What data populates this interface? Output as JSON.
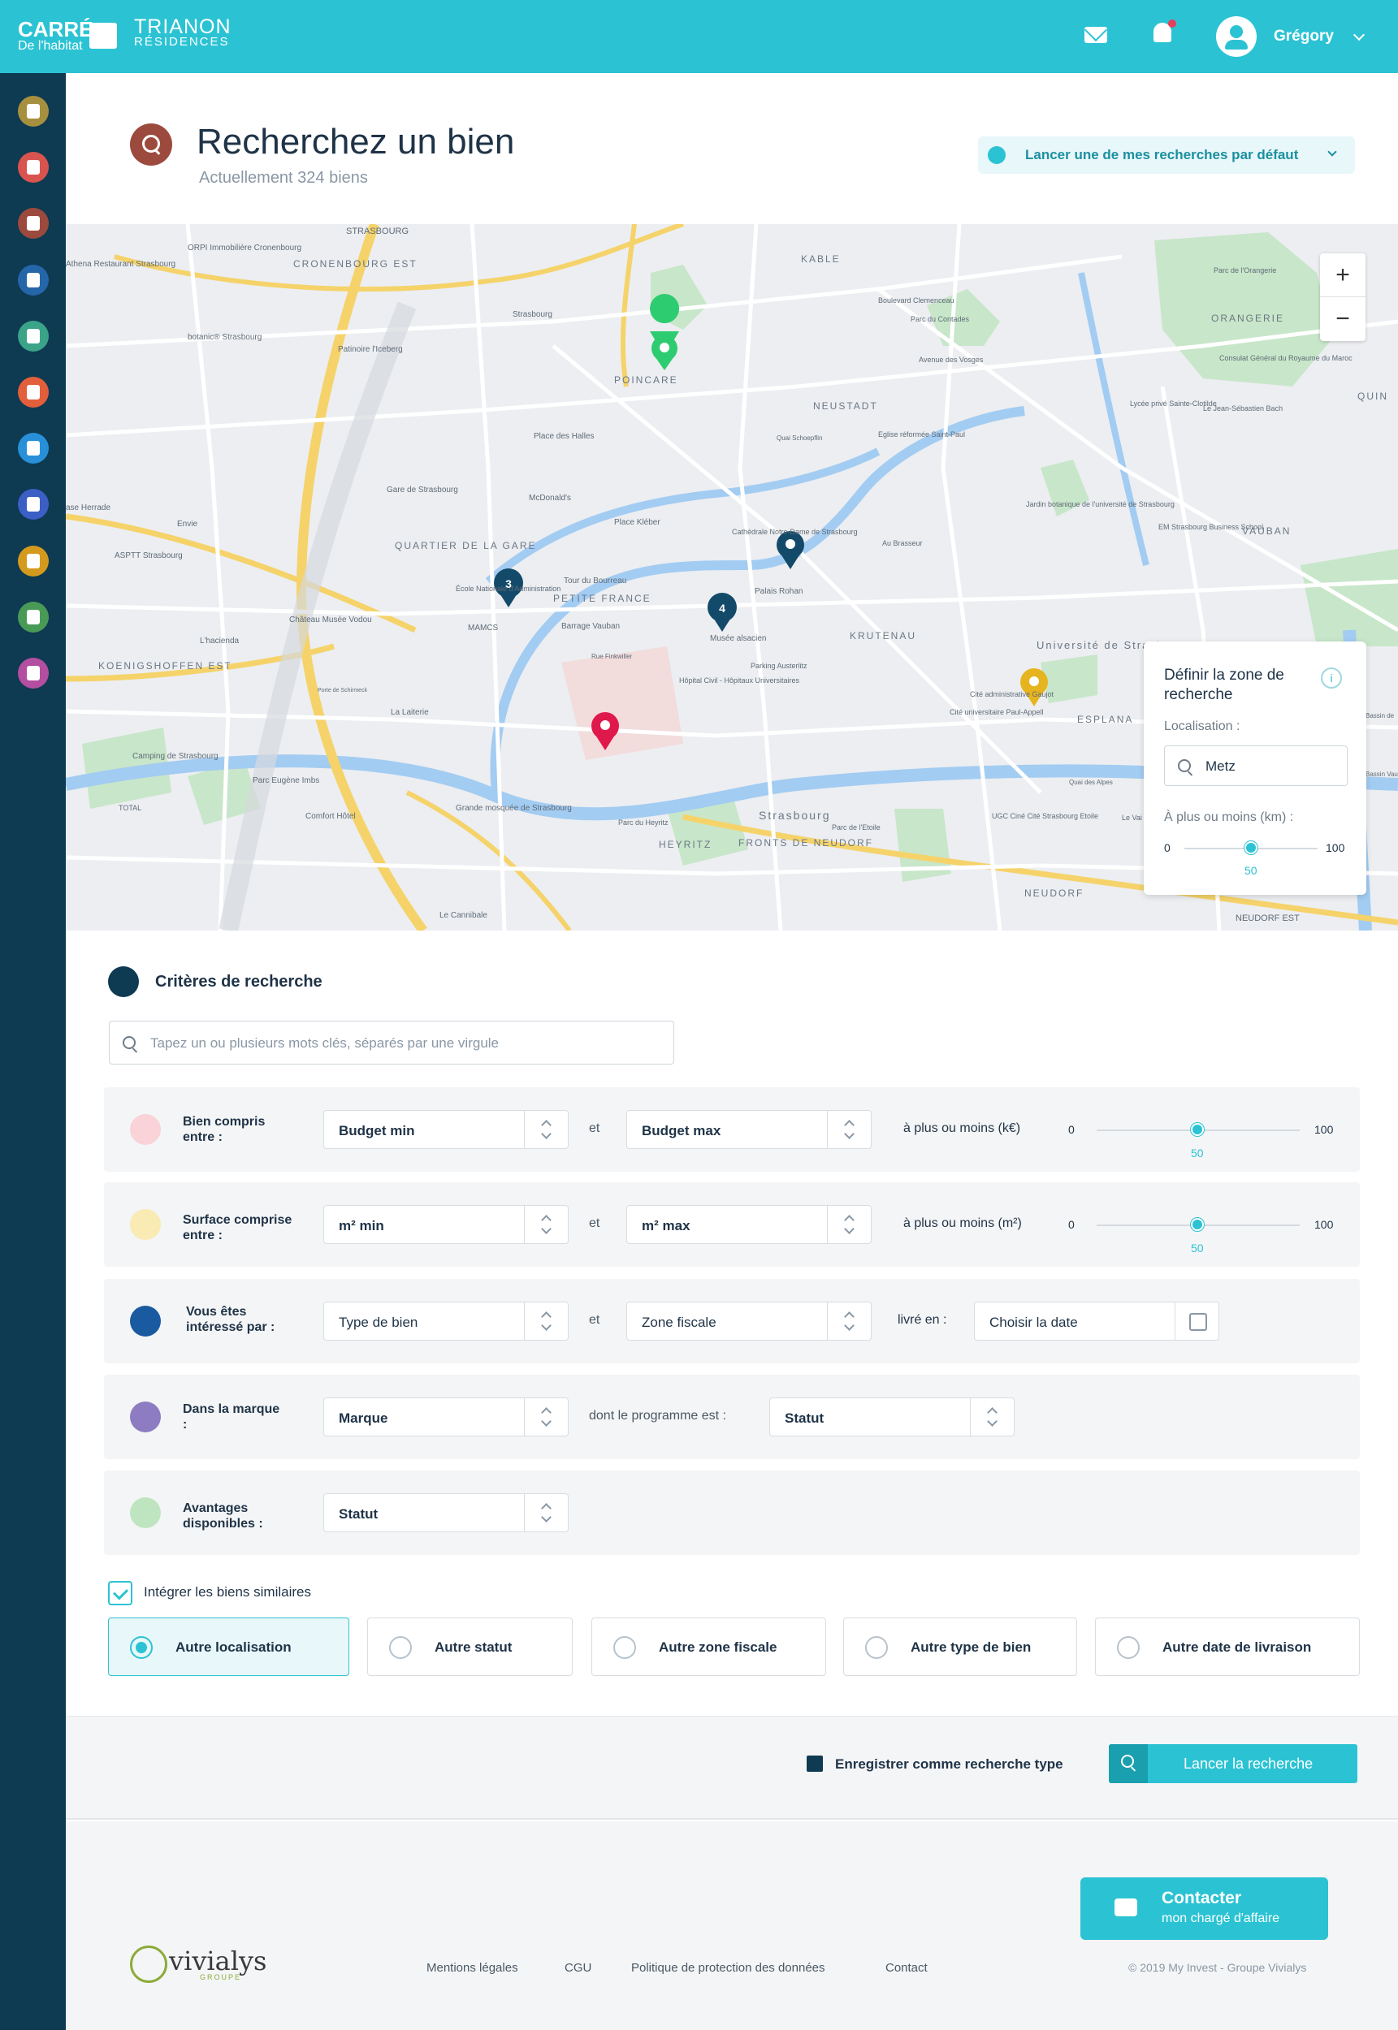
{
  "header": {
    "brand_main": "CARRÉ",
    "brand_sub": "De l'habitat",
    "brand2_main": "TRIANON",
    "brand2_sub": "RÉSIDENCES",
    "user_name": "Grégory",
    "accent_color": "#2bc3d3",
    "notification_dot_color": "#e83e5a"
  },
  "sidebar": {
    "background": "#0e3a52",
    "items": [
      {
        "icon": "clipboard-icon",
        "color": "#a6903f"
      },
      {
        "icon": "users-icon",
        "color": "#d9534f"
      },
      {
        "icon": "search-icon",
        "color": "#9c4a3d"
      },
      {
        "icon": "home-icon",
        "color": "#2466a8"
      },
      {
        "icon": "star-icon",
        "color": "#3aa388"
      },
      {
        "icon": "bell-icon",
        "color": "#e35f3b"
      },
      {
        "icon": "book-icon",
        "color": "#2790d8"
      },
      {
        "icon": "calendar-icon",
        "color": "#3b5fc4"
      },
      {
        "icon": "document-icon",
        "color": "#d49a1d"
      },
      {
        "icon": "stack-icon",
        "color": "#4a9a57"
      },
      {
        "icon": "profile-icon",
        "color": "#b34ea1"
      }
    ]
  },
  "page": {
    "title": "Recherchez un bien",
    "subtitle": "Actuellement 324 biens",
    "default_search_label": "Lancer une de mes recherches par défaut"
  },
  "map": {
    "labels": [
      "STRASBOURG",
      "Athena Restaurant Strasbourg",
      "ORPI Immobilière Cronenbourg",
      "CRONENBOURG EST",
      "KABLE",
      "botanic® Strasbourg",
      "Patinoire l'Iceberg",
      "Strasbourg",
      "Boulevard Clemenceau",
      "Parc du Contades",
      "Parc de l'Orangerie",
      "ORANGERIE",
      "Consulat Général du Royaume du Maroc",
      "QUIN",
      "POINCARE",
      "Avenue des Vosges",
      "NEUSTADT",
      "Lycée privé Sainte-Clotilde",
      "Le Jean-Sébastien Bach",
      "Place des Halles",
      "Quai Schoepflin",
      "Eglise réformée Saint-Paul",
      "Gare de Strasbourg",
      "McDonald's",
      "Place Kléber",
      "Jardin botanique de l'université de Strasbourg",
      "EM Strasbourg Business School",
      "VAUBAN",
      "ase Herrade",
      "Envie",
      "ASPTT Strasbourg",
      "QUARTIER DE LA GARE",
      "Cathédrale Notre-Dame de Strasbourg",
      "Au Brasseur",
      "École Nationale d'Administration",
      "Tour du Bourreau",
      "PETITE FRANCE",
      "Palais Rohan",
      "Château Musée Vodou",
      "MAMCS",
      "Barrage Vauban",
      "Musée alsacien",
      "KRUTENAU",
      "Université de Strasbourg",
      "L'hacienda",
      "KOENIGSHOFFEN EST",
      "Rue Finkwiller",
      "Hôpital Civil - Hôpitaux Universitaires",
      "Parking Austerlitz",
      "Cité administrative Gaujot",
      "Cité universitaire Paul-Appell",
      "ESPLANA",
      "Porte de Schirmeck",
      "La Laiterie",
      "Camping de Strasbourg",
      "Parc Eugène Imbs",
      "TOTAL",
      "Comfort Hôtel",
      "Grande mosquée de Strasbourg",
      "Strasbourg",
      "UGC Ciné Cité Strasbourg Etoile",
      "Quai des Alpes",
      "Le Vai",
      "Parc du Heyritz",
      "HEYRITZ",
      "FRONTS DE NEUDORF",
      "Parc de l'Etoile",
      "NEUDORF",
      "NEUDORF EST",
      "Le Cannibale",
      "Bassin Vauban",
      "Bassin de"
    ],
    "clusters": [
      {
        "count": "3"
      },
      {
        "count": "4"
      }
    ],
    "zoom_in": "+",
    "zoom_out": "−"
  },
  "zone_panel": {
    "title": "Définir la zone de recherche",
    "info": "i",
    "location_label": "Localisation :",
    "location_value": "Metz",
    "distance_label": "À plus ou moins (km) :",
    "slider": {
      "min": "0",
      "max": "100",
      "value": "50"
    }
  },
  "criteria": {
    "title": "Critères de recherche",
    "keywords_placeholder": "Tapez un ou plusieurs mots clés, séparés par une virgule",
    "rows": [
      {
        "label": "Bien compris entre :",
        "icon": "tag-icon",
        "icon_color": "#f4a0a8",
        "field1": "Budget min",
        "conj": "et",
        "field2": "Budget max",
        "extra_label": "à plus ou moins (k€)",
        "slider": {
          "min": "0",
          "max": "100",
          "value": "50"
        }
      },
      {
        "label": "Surface comprise entre :",
        "icon": "surface-icon",
        "icon_color": "#f0c85a",
        "field1": "m² min",
        "conj": "et",
        "field2": "m² max",
        "extra_label": "à plus ou moins (m²)",
        "slider": {
          "min": "0",
          "max": "100",
          "value": "50"
        }
      },
      {
        "label": "Vous êtes intéressé par :",
        "icon": "list-icon",
        "icon_color": "#2466a8",
        "field1": "Type de bien",
        "conj": "et",
        "field2": "Zone fiscale",
        "extra_label": "livré en :",
        "date_placeholder": "Choisir la date"
      },
      {
        "label": "Dans la marque :",
        "icon": "bookmark-icon",
        "icon_color": "#8e7cc3",
        "field1": "Marque",
        "conj": "dont le programme est :",
        "field2": "Statut"
      },
      {
        "label": "Avantages disponibles :",
        "icon": "thumbs-up-icon",
        "icon_color": "#a8d8a8",
        "field1": "Statut"
      }
    ],
    "similar_checkbox": "Intégrer les biens similaires",
    "options": [
      {
        "label": "Autre localisation",
        "selected": true
      },
      {
        "label": "Autre statut",
        "selected": false
      },
      {
        "label": "Autre zone fiscale",
        "selected": false
      },
      {
        "label": "Autre type de bien",
        "selected": false
      },
      {
        "label": "Autre date de livraison",
        "selected": false
      }
    ]
  },
  "actions": {
    "save_label": "Enregistrer comme recherche type",
    "launch_label": "Lancer la recherche"
  },
  "footer": {
    "contact_title": "Contacter",
    "contact_sub": "mon chargé d'affaire",
    "logo_text": "vivialys",
    "logo_sub": "GROUPE",
    "links": [
      "Mentions légales",
      "CGU",
      "Politique de protection des données",
      "Contact"
    ],
    "copyright": "© 2019 My Invest - Groupe Vivialys"
  }
}
